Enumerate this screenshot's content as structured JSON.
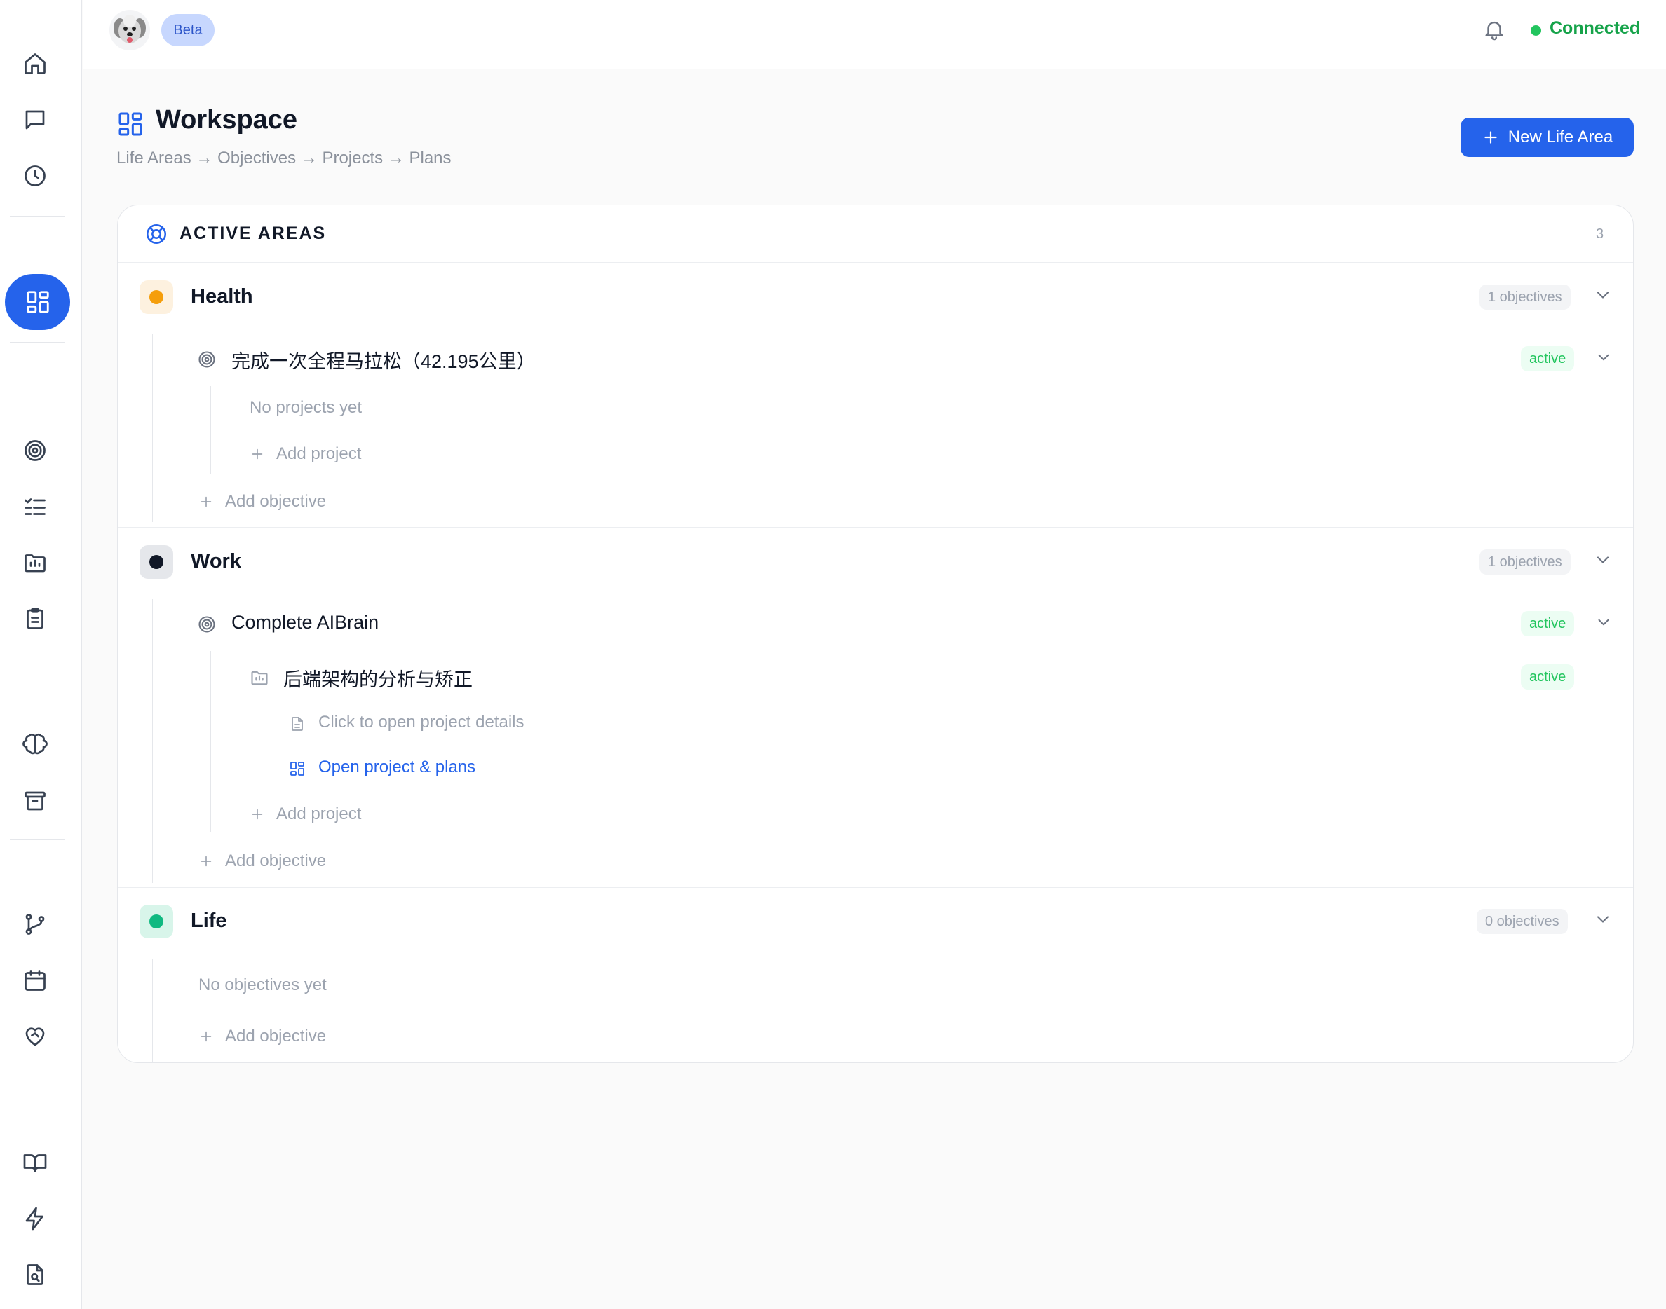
{
  "topbar": {
    "beta_label": "Beta",
    "connection_status": "Connected",
    "connection_color": "#22c55e"
  },
  "header": {
    "title": "Workspace",
    "breadcrumb": "Life Areas → Objectives → Projects → Plans",
    "new_button_label": "New Life Area"
  },
  "card": {
    "title": "ACTIVE AREAS",
    "count": "3"
  },
  "areas": [
    {
      "name": "Health",
      "color": "#f59e0b",
      "objectives_count": "1 objectives",
      "objectives": [
        {
          "title": "完成一次全程马拉松（42.195公里）",
          "status": "active",
          "empty_projects_text": "No projects yet",
          "add_project_label": "Add project"
        }
      ],
      "add_objective_label": "Add objective"
    },
    {
      "name": "Work",
      "color": "#111827",
      "objectives_count": "1 objectives",
      "objectives": [
        {
          "title": "Complete AIBrain",
          "status": "active",
          "projects": [
            {
              "title": "后端架构的分析与矫正",
              "status": "active",
              "details_hint": "Click to open project details",
              "open_link": "Open project & plans"
            }
          ],
          "add_project_label": "Add project"
        }
      ],
      "add_objective_label": "Add objective"
    },
    {
      "name": "Life",
      "color": "#10b981",
      "objectives_count": "0 objectives",
      "empty_objectives_text": "No objectives yet",
      "add_objective_label": "Add objective"
    }
  ],
  "icons": {
    "sidebar": [
      "home-icon",
      "chat-icon",
      "clock-icon",
      "workspace-grid-icon",
      "target-icon",
      "checklist-icon",
      "folder-chart-icon",
      "clipboard-icon",
      "brain-icon",
      "archive-icon",
      "git-branch-icon",
      "calendar-icon",
      "heart-handshake-icon",
      "book-icon",
      "lightning-icon",
      "file-search-icon"
    ]
  }
}
